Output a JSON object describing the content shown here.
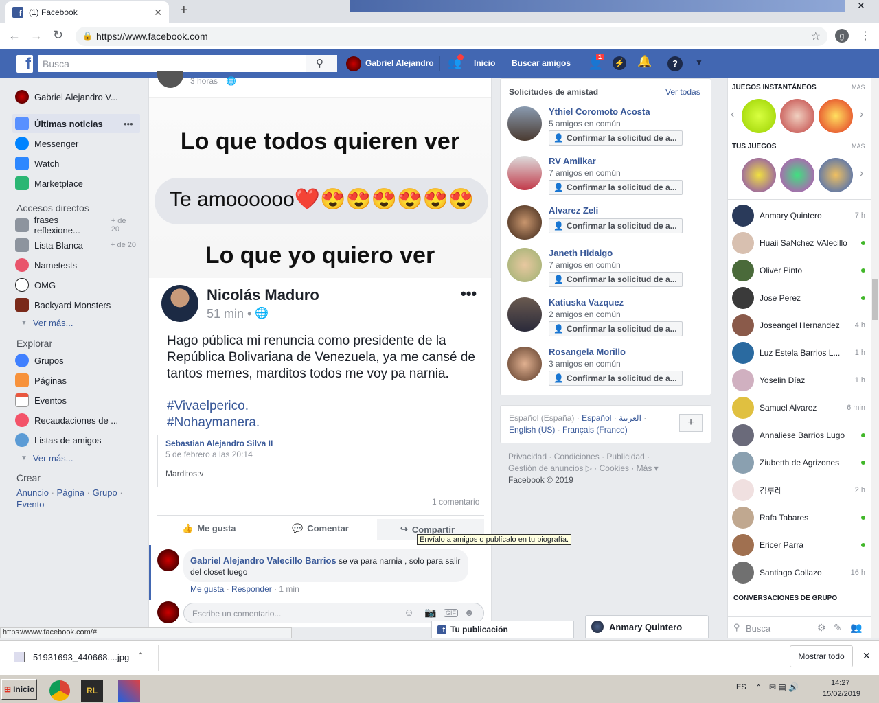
{
  "browser": {
    "tab_title": "(1) Facebook",
    "url": "https://www.facebook.com",
    "profile_initial": "g",
    "status_url": "https://www.facebook.com/#"
  },
  "header": {
    "search_placeholder": "Busca",
    "user_name": "Gabriel Alejandro",
    "home": "Inicio",
    "find_friends": "Buscar amigos",
    "friend_badge": "1"
  },
  "left": {
    "profile": "Gabriel Alejandro V...",
    "items": [
      {
        "label": "Últimas noticias"
      },
      {
        "label": "Messenger"
      },
      {
        "label": "Watch"
      },
      {
        "label": "Marketplace"
      }
    ],
    "shortcuts_title": "Accesos directos",
    "shortcuts": [
      {
        "label": "frases reflexione...",
        "sub": "+ de 20"
      },
      {
        "label": "Lista Blanca",
        "sub": "+ de 20"
      },
      {
        "label": "Nametests",
        "sub": ""
      },
      {
        "label": "OMG",
        "sub": ""
      },
      {
        "label": "Backyard Monsters",
        "sub": ""
      }
    ],
    "see_more": "Ver más...",
    "explore_title": "Explorar",
    "explore": [
      {
        "label": "Grupos"
      },
      {
        "label": "Páginas"
      },
      {
        "label": "Eventos"
      },
      {
        "label": "Recaudaciones de ..."
      },
      {
        "label": "Listas de amigos"
      }
    ],
    "see_more2": "Ver más...",
    "create_title": "Crear",
    "create_links": [
      "Anuncio",
      "Página",
      "Grupo",
      "Evento"
    ]
  },
  "post": {
    "time": "3 horas",
    "meme_line1": "Lo que todos quieren ver",
    "meme_bubble": "Te amoooooo❤️😍😍😍😍😍😍",
    "meme_line2": "Lo que yo quiero ver",
    "meme_author": "Nicolás Maduro",
    "meme_time": "51 min •",
    "meme_text": "Hago pública mi renuncia como presidente de la República Bolivariana de Venezuela, ya me cansé de tantos memes, marditos todos me voy pa narnia.",
    "meme_tag1": "#Vivaelperico.",
    "meme_tag2": "#Nohaymanera.",
    "shared_author": "Sebastian Alejandro Silva II",
    "shared_date": "5 de febrero a las 20:14",
    "shared_text": "Marditos:v",
    "comments_count": "1 comentario",
    "like": "Me gusta",
    "comment": "Comentar",
    "share": "Compartir",
    "tooltip": "Envíalo a amigos o publícalo en tu biografía.",
    "c_author": "Gabriel Alejandro Valecillo Barrios",
    "c_text": "se va para narnia , solo para salir del closet luego",
    "c_like": "Me gusta",
    "c_reply": "Responder",
    "c_time": "1 min",
    "write_placeholder": "Escribe un comentario..."
  },
  "requests": {
    "title": "Solicitudes de amistad",
    "see_all": "Ver todas",
    "button": "Confirmar la solicitud de a...",
    "items": [
      {
        "name": "Ythiel Coromoto Acosta",
        "mutual": "5 amigos en común"
      },
      {
        "name": "RV Amilkar",
        "mutual": "7 amigos en común"
      },
      {
        "name": "Alvarez Zeli",
        "mutual": ""
      },
      {
        "name": "Janeth Hidalgo",
        "mutual": "7 amigos en común"
      },
      {
        "name": "Katiuska Vazquez",
        "mutual": "2 amigos en común"
      },
      {
        "name": "Rosangela Morillo",
        "mutual": "3 amigos en común"
      }
    ]
  },
  "langs": {
    "l1": "Español (España)",
    "l2": "Español",
    "l3": "العربية",
    "l4": "English (US)",
    "l5": "Français (France)"
  },
  "footer": {
    "line1": "Privacidad · Condiciones · Publicidad ·",
    "line2": "Gestión de anuncios ▷ · Cookies · Más ▾",
    "line3": "Facebook © 2019"
  },
  "chat": {
    "games_title": "JUEGOS INSTANTÁNEOS",
    "more": "MÁS",
    "your_games": "TUS JUEGOS",
    "contacts": [
      {
        "name": "Anmary Quintero",
        "time": "7 h"
      },
      {
        "name": "Huaii SaNchez VAlecillo",
        "time": ""
      },
      {
        "name": "Oliver Pinto",
        "time": ""
      },
      {
        "name": "Jose Perez",
        "time": ""
      },
      {
        "name": "Joseangel Hernandez",
        "time": "4 h"
      },
      {
        "name": "Luz Estela Barrios L...",
        "time": "1 h"
      },
      {
        "name": "Yoselin Díaz",
        "time": "1 h"
      },
      {
        "name": "Samuel Alvarez",
        "time": "6 min"
      },
      {
        "name": "Annaliese Barrios Lugo",
        "time": ""
      },
      {
        "name": "Ziubetth de Agrizones",
        "time": ""
      },
      {
        "name": "김루레",
        "time": "2 h"
      },
      {
        "name": "Rafa Tabares",
        "time": ""
      },
      {
        "name": "Ericer Parra",
        "time": ""
      },
      {
        "name": "Santiago Collazo",
        "time": "16 h"
      }
    ],
    "group_title": "CONVERSACIONES DE GRUPO",
    "search": "Busca"
  },
  "docks": {
    "pub": "Tu publicación",
    "chat": "Anmary Quintero"
  },
  "download": {
    "file": "51931693_440668....jpg",
    "show_all": "Mostrar todo"
  },
  "taskbar": {
    "start": "Inicio",
    "lang": "ES",
    "time": "14:27",
    "date": "15/02/2019"
  }
}
